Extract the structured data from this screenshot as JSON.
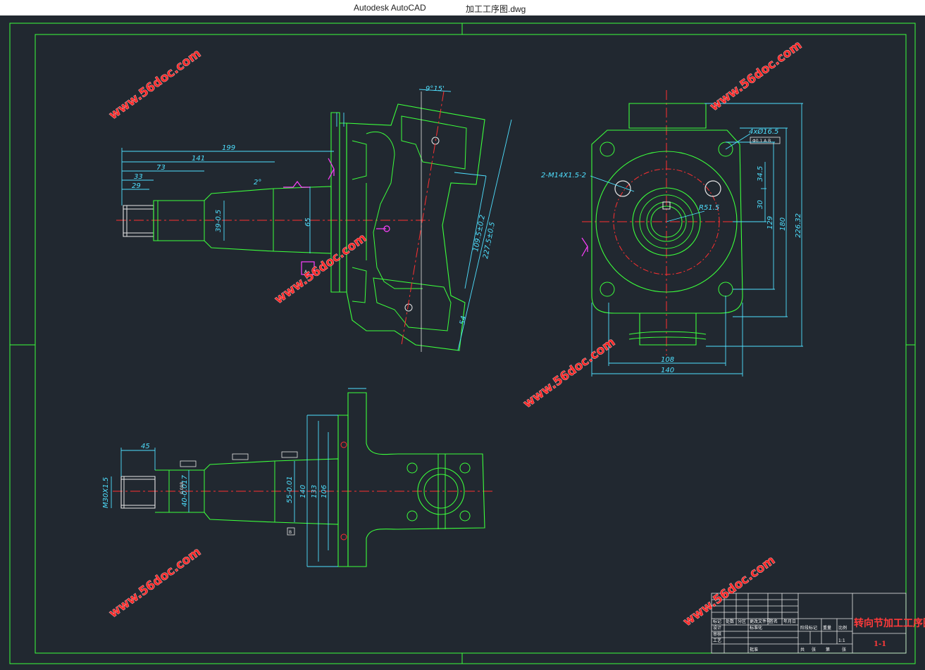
{
  "window": {
    "app_title": "Autodesk AutoCAD",
    "document_title": "加工工序图.dwg"
  },
  "watermark": "www.56doc.com",
  "dimensions": {
    "front": [
      "199",
      "141",
      "73",
      "33",
      "29",
      "2°",
      "39-0.5",
      "65",
      "9°15'",
      "109.5±0.2",
      "227.5±0.5",
      "54"
    ],
    "side": [
      "2-M14X1.5-2",
      "4xØ16.5",
      "Φ0.1 A B",
      "R51.5",
      "34.5",
      "30",
      "129",
      "180",
      "226.32",
      "108",
      "140"
    ],
    "bottom": [
      "45",
      "M30X1.5",
      "40-0.017",
      "0.008",
      "55-0.01",
      "140",
      "133",
      "106"
    ],
    "datums": [
      "A",
      "B"
    ]
  },
  "title_block": {
    "drawing_name": "转向节加工工序图",
    "scale": "1:1",
    "sheet": "1-1",
    "cells": [
      "标记",
      "处数",
      "分区",
      "更改文件号",
      "签名",
      "年月日",
      "设计",
      "标准化",
      "阶段标记",
      "重量",
      "比例",
      "审核",
      "工艺",
      "批准",
      "共",
      "张",
      "第",
      "张"
    ]
  }
}
